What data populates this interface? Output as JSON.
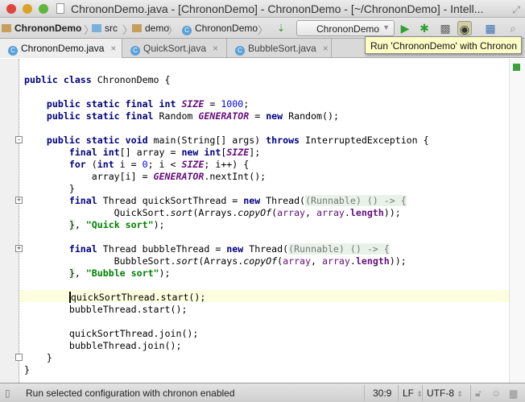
{
  "window": {
    "title": "ChrononDemo.java - [ChrononDemo] - ChrononDemo - [~/ChrononDemo] - Intell..."
  },
  "breadcrumbs": [
    "ChrononDemo",
    "src",
    "demo",
    "ChrononDemo"
  ],
  "run_config": {
    "selected": "ChrononDemo"
  },
  "tooltip": "Run 'ChrononDemo' with Chronon",
  "tabs": [
    {
      "label": "ChrononDemo.java",
      "close": "×"
    },
    {
      "label": "QuickSort.java",
      "close": "×"
    },
    {
      "label": "BubbleSort.java",
      "close": "×"
    }
  ],
  "code_lines": [
    [],
    [
      [
        "kw",
        "public class "
      ],
      [
        "",
        "ChrononDemo {"
      ]
    ],
    [],
    [
      [
        "kw",
        "    public static final int "
      ],
      [
        "const",
        "SIZE"
      ],
      [
        "",
        " = "
      ],
      [
        "num",
        "1000"
      ],
      [
        "",
        ";"
      ]
    ],
    [
      [
        "kw",
        "    public static final "
      ],
      [
        "",
        "Random "
      ],
      [
        "const",
        "GENERATOR"
      ],
      [
        "",
        " = "
      ],
      [
        "kw",
        "new "
      ],
      [
        "",
        "Random();"
      ]
    ],
    [],
    [
      [
        "kw",
        "    public static void "
      ],
      [
        "",
        "main(String[] args) "
      ],
      [
        "kw",
        "throws "
      ],
      [
        "",
        "InterruptedException {"
      ]
    ],
    [
      [
        "kw",
        "        final int"
      ],
      [
        "",
        "[] array = "
      ],
      [
        "kw",
        "new int"
      ],
      [
        "",
        "["
      ],
      [
        "const",
        "SIZE"
      ],
      [
        "",
        "];"
      ]
    ],
    [
      [
        "kw",
        "        for "
      ],
      [
        "",
        "("
      ],
      [
        "kw",
        "int "
      ],
      [
        "",
        "i = "
      ],
      [
        "num",
        "0"
      ],
      [
        "",
        "; i < "
      ],
      [
        "const",
        "SIZE"
      ],
      [
        "",
        "; i++) {"
      ]
    ],
    [
      [
        "",
        "            array[i] = "
      ],
      [
        "const",
        "GENERATOR"
      ],
      [
        "",
        ".nextInt();"
      ]
    ],
    [
      [
        "",
        "        }"
      ]
    ],
    [
      [
        "kw",
        "        final "
      ],
      [
        "",
        "Thread quickSortThread = "
      ],
      [
        "kw",
        "new "
      ],
      [
        "",
        "Thread("
      ],
      [
        "lam",
        "(Runnable) () -> {"
      ]
    ],
    [
      [
        "",
        "                QuickSort."
      ],
      [
        "it",
        "sort"
      ],
      [
        "",
        "(Arrays."
      ],
      [
        "it",
        "copyOf"
      ],
      [
        "",
        "("
      ],
      [
        "fld",
        "array"
      ],
      [
        "",
        ", "
      ],
      [
        "fld",
        "array"
      ],
      [
        "",
        "."
      ],
      [
        "fldb",
        "length"
      ],
      [
        "",
        "));"
      ]
    ],
    [
      [
        "",
        "        "
      ],
      [
        "lamb",
        "}"
      ],
      [
        "",
        ", "
      ],
      [
        "str",
        "\"Quick sort\""
      ],
      [
        "",
        ");"
      ]
    ],
    [],
    [
      [
        "kw",
        "        final "
      ],
      [
        "",
        "Thread bubbleThread = "
      ],
      [
        "kw",
        "new "
      ],
      [
        "",
        "Thread("
      ],
      [
        "lam",
        "(Runnable) () -> {"
      ]
    ],
    [
      [
        "",
        "                BubbleSort."
      ],
      [
        "it",
        "sort"
      ],
      [
        "",
        "(Arrays."
      ],
      [
        "it",
        "copyOf"
      ],
      [
        "",
        "("
      ],
      [
        "fld",
        "array"
      ],
      [
        "",
        ", "
      ],
      [
        "fld",
        "array"
      ],
      [
        "",
        "."
      ],
      [
        "fldb",
        "length"
      ],
      [
        "",
        "));"
      ]
    ],
    [
      [
        "",
        "        "
      ],
      [
        "lamb",
        "}"
      ],
      [
        "",
        ", "
      ],
      [
        "str",
        "\"Bubble sort\""
      ],
      [
        "",
        ");"
      ]
    ],
    [],
    [
      [
        "",
        "        "
      ],
      [
        "caret",
        "q"
      ],
      [
        "",
        "uickSortThread.start();"
      ]
    ],
    [
      [
        "",
        "        bubbleThread.start();"
      ]
    ],
    [],
    [
      [
        "",
        "        quickSortThread.join();"
      ]
    ],
    [
      [
        "",
        "        bubbleThread.join();"
      ]
    ],
    [
      [
        "",
        "    }"
      ]
    ],
    [
      [
        "",
        "}"
      ]
    ]
  ],
  "status": {
    "message": "Run selected configuration with chronon enabled",
    "position": "30:9",
    "line_sep": "LF",
    "encoding": "UTF-8"
  },
  "colors": {
    "keyword": "#000080",
    "constant": "#660e7a",
    "string": "#008000",
    "number": "#0000ff",
    "current_line": "#fdfde0"
  }
}
